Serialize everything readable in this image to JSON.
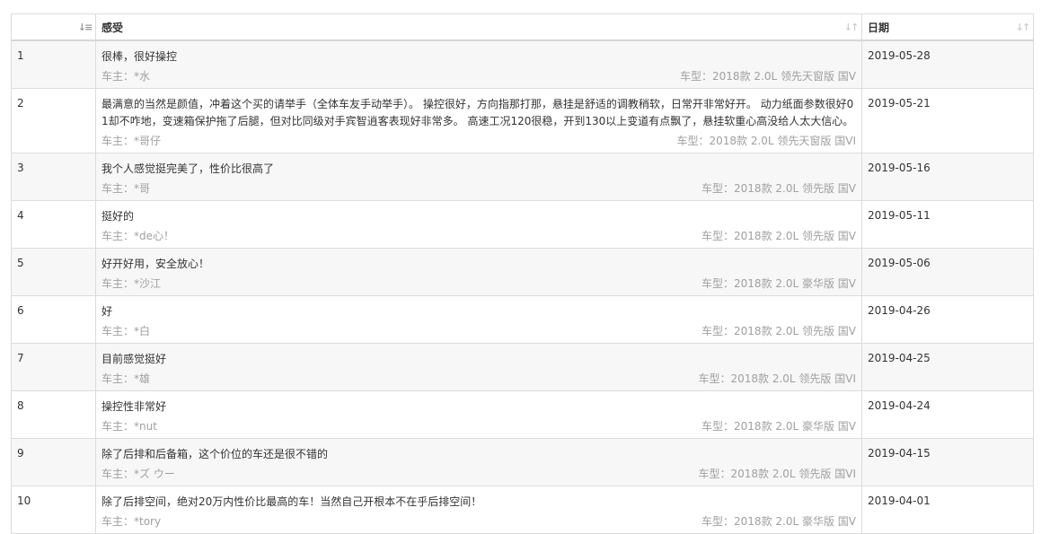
{
  "header": {
    "index_label": "",
    "feel_label": "感受",
    "date_label": "日期",
    "sort_icon_name": "sort-numeric-asc-icon"
  },
  "rows": [
    {
      "index": "1",
      "comment": "很棒，很好操控",
      "owner": "车主：*水",
      "model": "车型：2018款 2.0L 领先天窗版 国V",
      "date": "2019-05-28"
    },
    {
      "index": "2",
      "comment": "最满意的当然是颜值，冲着这个买的请举手（全体车友手动举手）。 操控很好，方向指那打那，悬挂是舒适的调教稍软，日常开非常好开。 动力纸面参数很好01却不咋地，变速箱保护拖了后腿，但对比同级对手宾智逍客表现好非常多。 高速工况120很稳，开到130以上变道有点飘了，悬挂软重心高没给人太大信心。",
      "owner": "车主：*哥仔",
      "model": "车型：2018款 2.0L 领先天窗版 国VI",
      "date": "2019-05-21"
    },
    {
      "index": "3",
      "comment": "我个人感觉挺完美了，性价比很高了",
      "owner": "车主：*哥",
      "model": "车型：2018款 2.0L 领先版 国V",
      "date": "2019-05-16"
    },
    {
      "index": "4",
      "comment": "挺好的",
      "owner": "车主：*de心！",
      "model": "车型：2018款 2.0L 领先版 国V",
      "date": "2019-05-11"
    },
    {
      "index": "5",
      "comment": "好开好用，安全放心！",
      "owner": "车主：*沙江",
      "model": "车型：2018款 2.0L 豪华版 国V",
      "date": "2019-05-06"
    },
    {
      "index": "6",
      "comment": "好",
      "owner": "车主：*白",
      "model": "车型：2018款 2.0L 领先版 国V",
      "date": "2019-04-26"
    },
    {
      "index": "7",
      "comment": "目前感觉挺好",
      "owner": "车主：*雄",
      "model": "车型：2018款 2.0L 领先版 国VI",
      "date": "2019-04-25"
    },
    {
      "index": "8",
      "comment": "操控性非常好",
      "owner": "车主：*nut",
      "model": "车型：2018款 2.0L 豪华版 国V",
      "date": "2019-04-24"
    },
    {
      "index": "9",
      "comment": "除了后排和后备箱，这个价位的车还是很不错的",
      "owner": "车主：*ズ ウー",
      "model": "车型：2018款 2.0L 领先版 国VI",
      "date": "2019-04-15"
    },
    {
      "index": "10",
      "comment": "除了后排空间，绝对20万内性价比最高的车！当然自己开根本不在乎后排空间！",
      "owner": "车主：*tory",
      "model": "车型：2018款 2.0L 豪华版 国V",
      "date": "2019-04-01"
    }
  ]
}
